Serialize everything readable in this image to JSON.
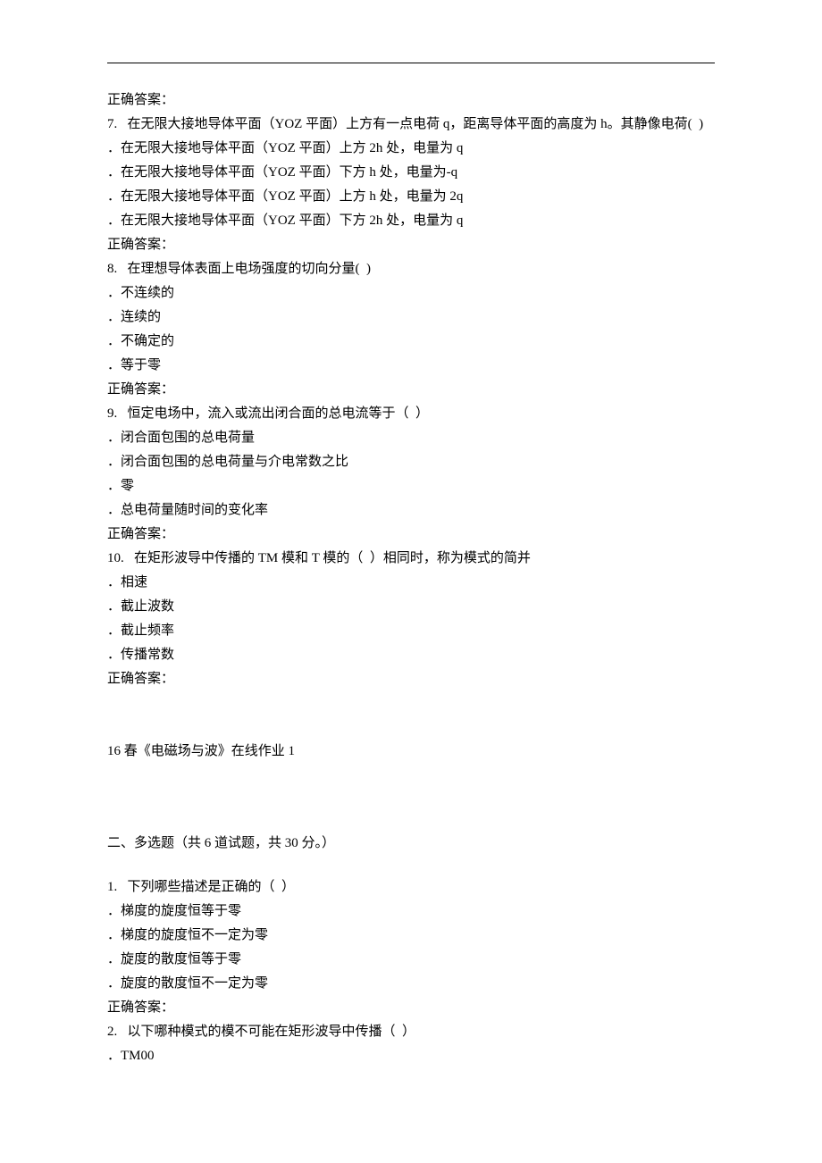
{
  "q6_answer": "正确答案：",
  "q7": {
    "stem": "7.   在无限大接地导体平面（YOZ 平面）上方有一点电荷 q，距离导体平面的高度为 h。其静像电荷(  )",
    "options": [
      "．在无限大接地导体平面（YOZ 平面）上方 2h 处，电量为 q",
      "．在无限大接地导体平面（YOZ 平面）下方 h 处，电量为-q",
      "．在无限大接地导体平面（YOZ 平面）上方 h 处，电量为 2q",
      "．在无限大接地导体平面（YOZ 平面）下方 2h 处，电量为 q"
    ],
    "answer": "正确答案："
  },
  "q8": {
    "stem": "8.   在理想导体表面上电场强度的切向分量(  )",
    "options": [
      "．不连续的",
      "．连续的",
      "．不确定的",
      "．等于零"
    ],
    "answer": "正确答案："
  },
  "q9": {
    "stem": "9.   恒定电场中，流入或流出闭合面的总电流等于（  ）",
    "options": [
      "．闭合面包围的总电荷量",
      "．闭合面包围的总电荷量与介电常数之比",
      "．零",
      "．总电荷量随时间的变化率"
    ],
    "answer": "正确答案："
  },
  "q10": {
    "stem": "10.   在矩形波导中传播的 TM 模和 T 模的（  ）相同时，称为模式的简并",
    "options": [
      "．相速",
      "．截止波数",
      "．截止频率",
      "．传播常数"
    ],
    "answer": "正确答案："
  },
  "course_title": "16 春《电磁场与波》在线作业 1",
  "section2_title": "二、多选题（共 6 道试题，共 30 分。）",
  "mq1": {
    "stem": "1.   下列哪些描述是正确的（  ）",
    "options": [
      "．梯度的旋度恒等于零",
      "．梯度的旋度恒不一定为零",
      "．旋度的散度恒等于零",
      "．旋度的散度恒不一定为零"
    ],
    "answer": "正确答案："
  },
  "mq2": {
    "stem": "2.   以下哪种模式的模不可能在矩形波导中传播（  ）",
    "options": [
      "．TM00"
    ]
  }
}
